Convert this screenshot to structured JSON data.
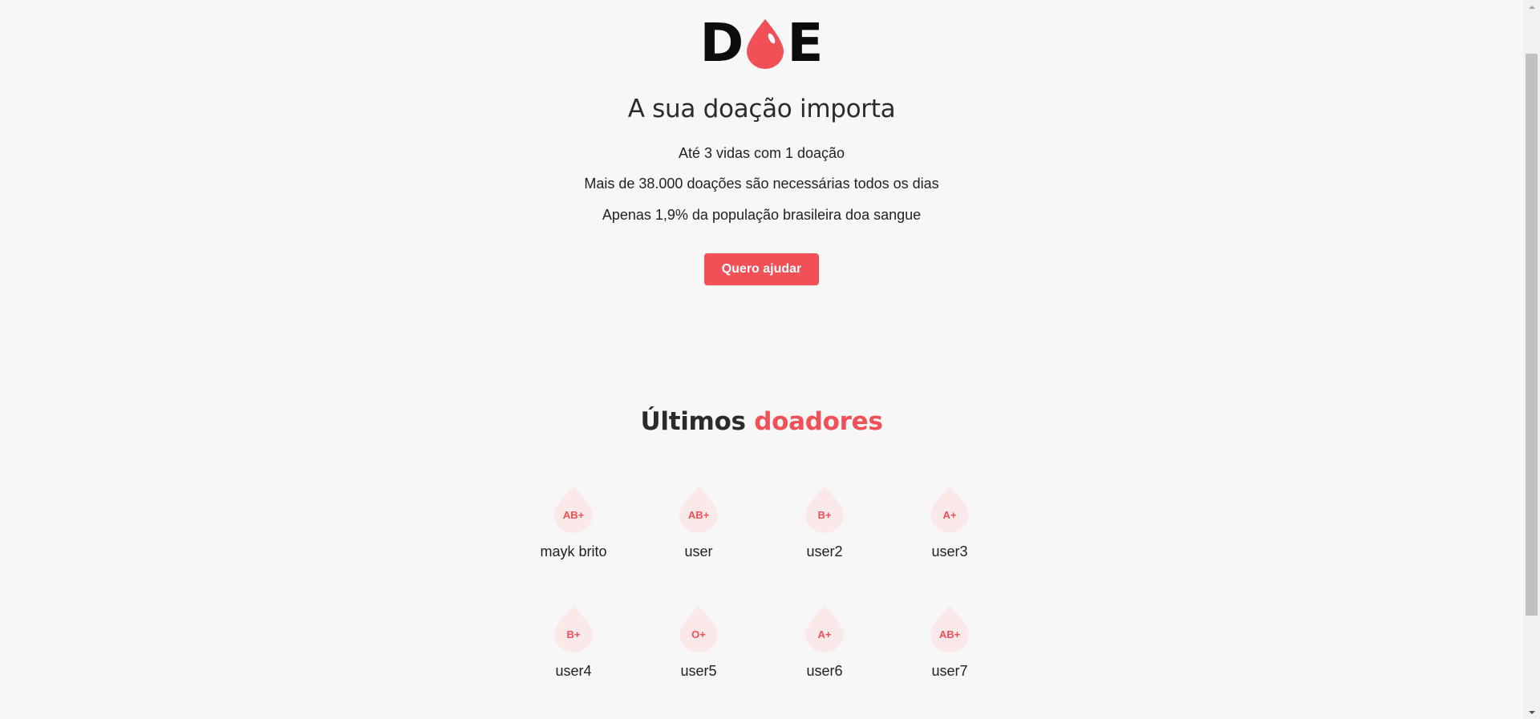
{
  "logo": {
    "letter_left": "D",
    "letter_right": "E",
    "icon": "blood-drop-icon"
  },
  "hero": {
    "title": "A sua doação importa",
    "facts": [
      "Até 3 vidas com 1 doação",
      "Mais de 38.000 doações são necessárias todos os dias",
      "Apenas 1,9% da população brasileira doa sangue"
    ],
    "cta_label": "Quero ajudar"
  },
  "donors_section": {
    "title_part1": "Últimos",
    "title_part2": "doadores",
    "donors": [
      {
        "name": "mayk brito",
        "blood": "AB+"
      },
      {
        "name": "user",
        "blood": "AB+"
      },
      {
        "name": "user2",
        "blood": "B+"
      },
      {
        "name": "user3",
        "blood": "A+"
      },
      {
        "name": "user4",
        "blood": "B+"
      },
      {
        "name": "user5",
        "blood": "O+"
      },
      {
        "name": "user6",
        "blood": "A+"
      },
      {
        "name": "user7",
        "blood": "AB+"
      }
    ]
  },
  "colors": {
    "accent": "#f25057",
    "badge_bg": "#fbe9ea",
    "background": "#f7f7f7"
  }
}
